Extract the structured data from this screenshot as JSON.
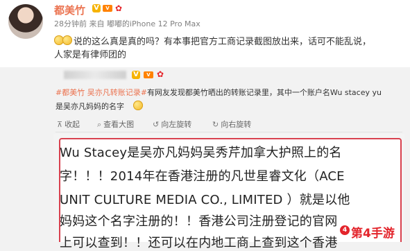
{
  "post": {
    "username": "都美竹",
    "meta": "28分钟前  来自 嘟嘟的iPhone 12 Pro Max",
    "text_line1": "说的这么真是真的吗？有本事把官方工商记录截图放出来，话可不能乱说，",
    "text_line2": "人家是有律师团的"
  },
  "repost": {
    "tags": "#都美竹 吴亦凡转账记录#",
    "text_line1_rest": "有网友发现都美竹晒出的转账记录里，其中一个账户名Wu stacey yu",
    "text_line2": "是吴亦凡妈妈的名字",
    "toolbar": {
      "collapse": "收起",
      "view_large": "查看大图",
      "rotate_left": "向左旋转",
      "rotate_right": "向右旋转"
    },
    "icons": {
      "collapse": "collapse-icon",
      "view_large": "zoom-icon",
      "rotate_left": "rotate-left-icon",
      "rotate_right": "rotate-right-icon"
    }
  },
  "image": {
    "line1": "Wu Stacey是吴亦凡妈妈吴秀芹加拿大护照上的名",
    "line2": "字！！！2014年在香港注册的凡世星睿文化（ACE",
    "line3": "UNIT CULTURE MEDIA CO., LIMITED ）就是以他",
    "line4": "妈妈这个名字注册的！！香港公司注册登记的官网",
    "line5": "上可以查到！！还可以在内地工商上查到这个香港"
  },
  "watermark": {
    "text": "第4手游",
    "logo": "4"
  },
  "colors": {
    "accent": "#eb7350",
    "border_red": "#d8414e",
    "watermark": "#e3242b"
  }
}
